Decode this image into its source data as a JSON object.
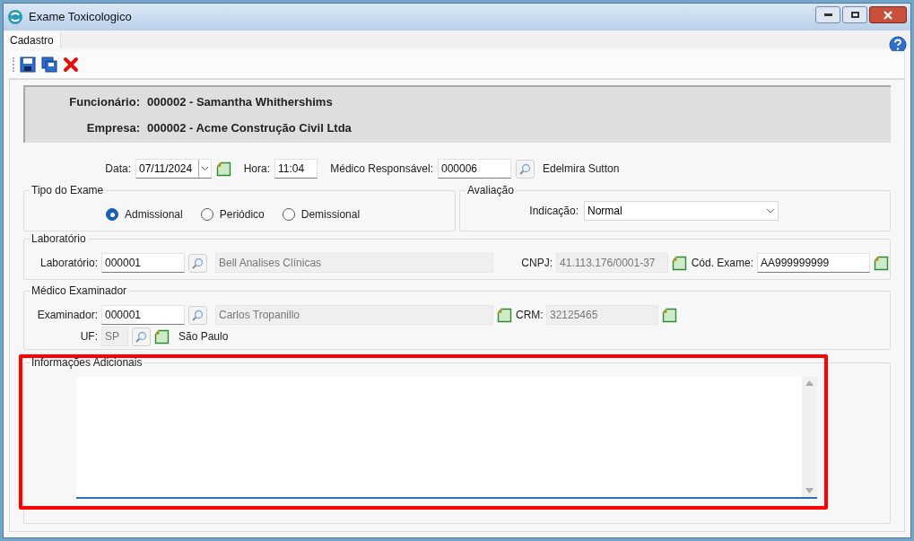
{
  "window": {
    "title": "Exame Toxicologico"
  },
  "tabs": [
    {
      "label": "Cadastro",
      "selected": true
    }
  ],
  "header": [
    {
      "label": "Funcionário:",
      "value": "000002 - Samantha Whithershims"
    },
    {
      "label": "Empresa:",
      "value": "000002 - Acme Construção Civil Ltda"
    }
  ],
  "top_row": {
    "date_label": "Data:",
    "date": "07/11/2024",
    "time_label": "Hora:",
    "time": "11:04",
    "doctor_label": "Médico Responsável:",
    "doctor_code": "000006",
    "doctor_name": "Edelmira Sutton"
  },
  "tipo_exame": {
    "title": "Tipo do Exame",
    "options": [
      {
        "label": "Admissional",
        "selected": true
      },
      {
        "label": "Periódico",
        "selected": false
      },
      {
        "label": "Demissional",
        "selected": false
      }
    ]
  },
  "avaliacao": {
    "title": "Avaliação",
    "label": "Indicação:",
    "value": "Normal"
  },
  "laboratorio": {
    "title": "Laboratório",
    "code_label": "Laboratório:",
    "code": "000001",
    "name": "Bell Analises Clínicas",
    "cnpj_label": "CNPJ:",
    "cnpj": "41.113.176/0001-37",
    "exam_code_label": "Cód. Exame:",
    "exam_code": "AA999999999"
  },
  "medico_examinador": {
    "title": "Médico Examinador",
    "code_label": "Examinador:",
    "code": "000001",
    "name": "Carlos Tropanillo",
    "crm_label": "CRM:",
    "crm": "32125465",
    "uf_label": "UF:",
    "uf": "SP",
    "uf_name": "São Paulo"
  },
  "informacoes_adicionais": {
    "title": "Informações Adicionais",
    "highlighted": true
  }
}
